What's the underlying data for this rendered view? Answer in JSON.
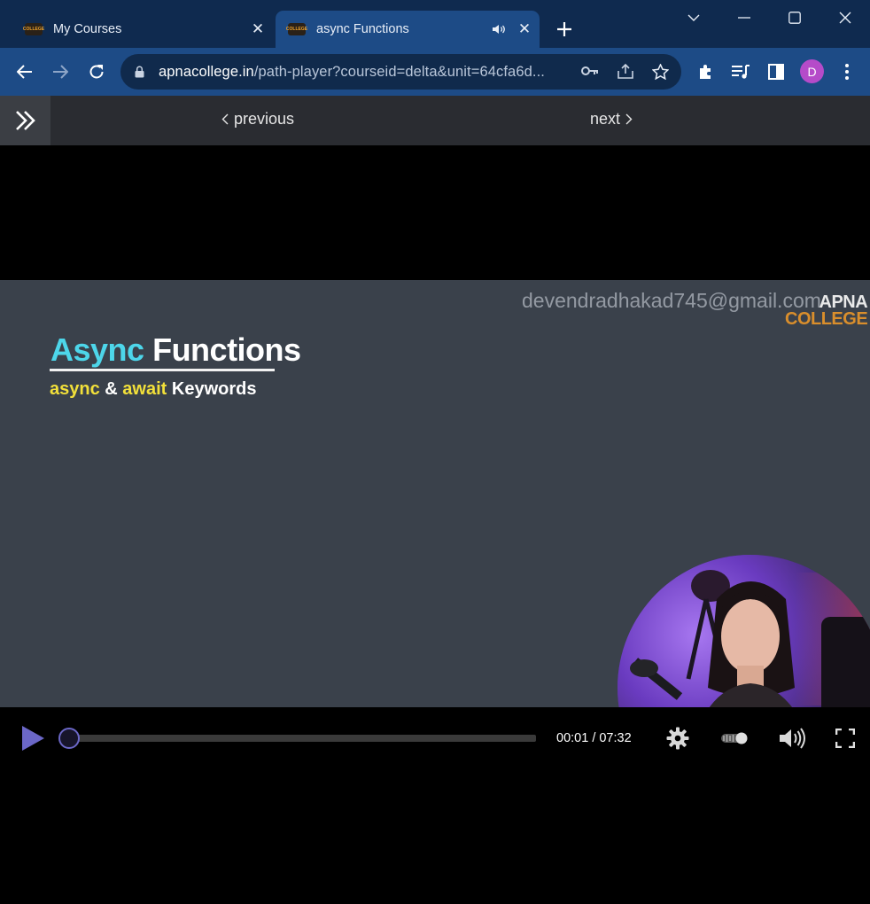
{
  "browser": {
    "tabs": [
      {
        "title": "My Courses",
        "active": false,
        "favicon": "apna-college-favicon"
      },
      {
        "title": "async Functions",
        "active": true,
        "playing_audio": true,
        "favicon": "apna-college-favicon"
      }
    ],
    "url": {
      "host": "apnacollege.in",
      "path": "/path-player?courseid=delta&unit=64cfa6d..."
    },
    "profile_initial": "D",
    "favicon_text": "COLLEGE"
  },
  "nav": {
    "previous_label": "previous",
    "next_label": "next"
  },
  "video": {
    "watermark": "devendradhakad745@gmail.com",
    "brand_line1": "APNA",
    "brand_line2": "COLLEGE",
    "slide_title_word1": "Async",
    "slide_title_word2": "Functions",
    "slide_sub_k1": "async",
    "slide_sub_amp": "&",
    "slide_sub_k2": "await",
    "slide_sub_rest": "Keywords"
  },
  "player": {
    "current_time": "00:01",
    "duration": "07:32",
    "time_display": "00:01 / 07:32",
    "progress": 0.002
  },
  "colors": {
    "accent": "#6b67c7",
    "browser_frame": "#0f2a4f",
    "browser_toolbar": "#1d4b86",
    "slide_bg": "#3a414b",
    "title_cyan": "#4dd6ea",
    "keyword_yellow": "#f2e03a",
    "brand_orange": "#d98e2c"
  }
}
